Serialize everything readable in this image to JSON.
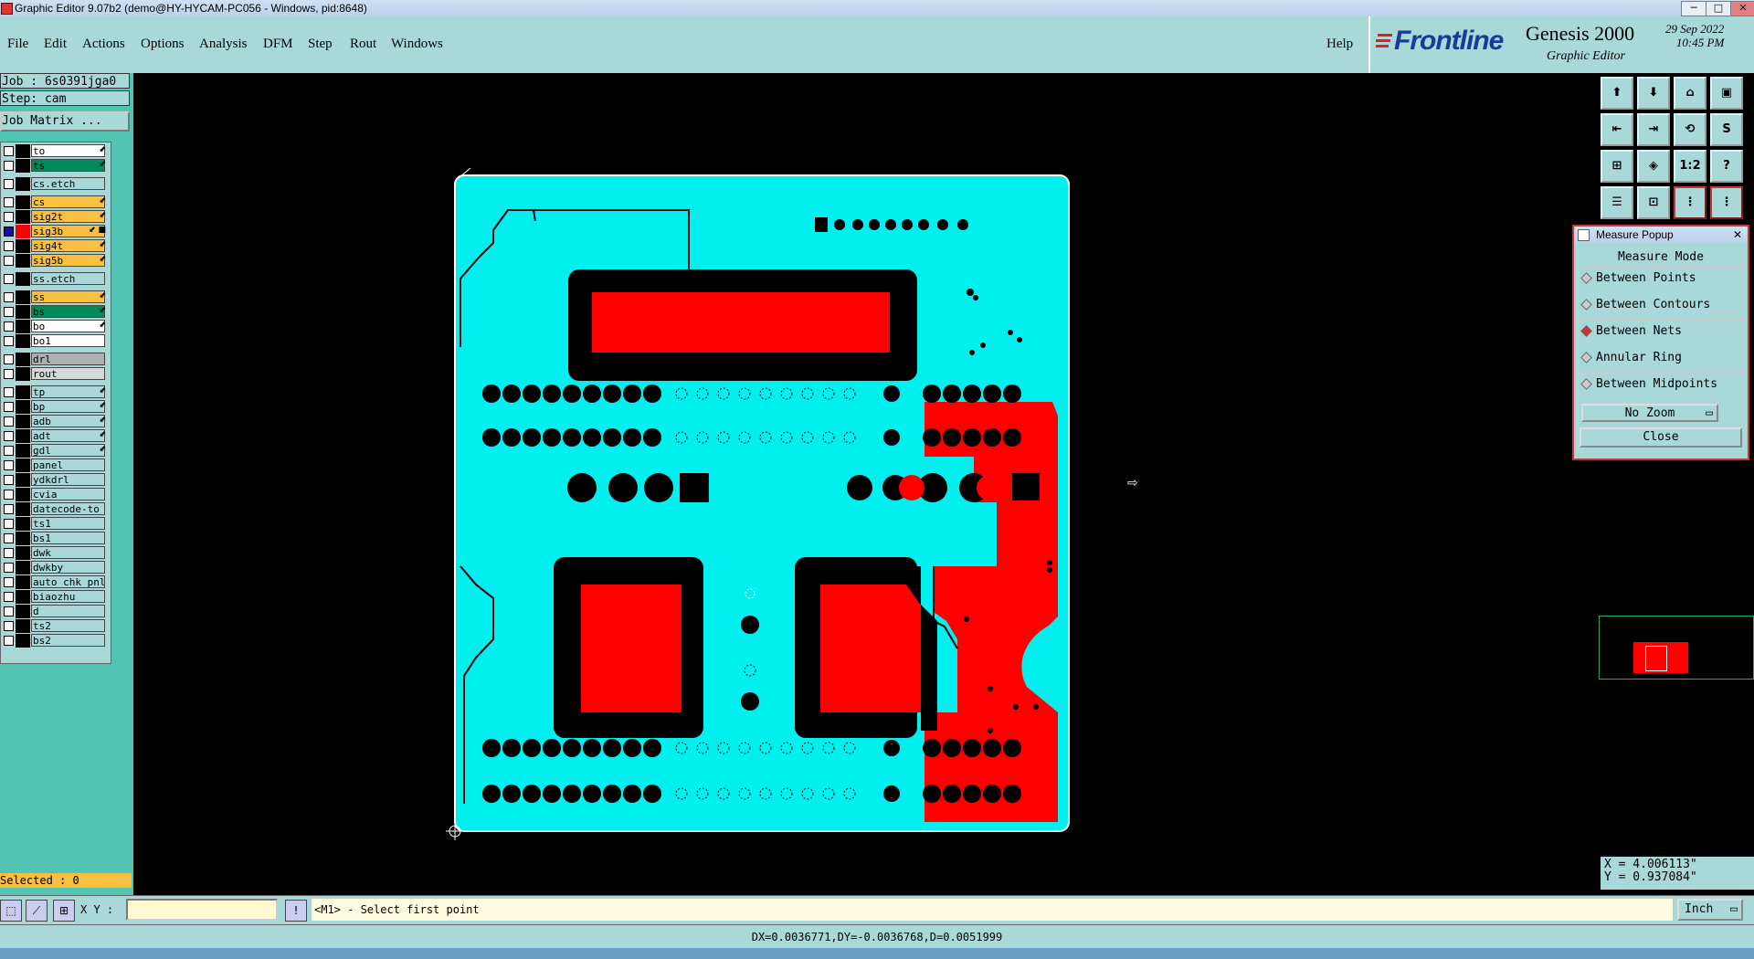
{
  "window": {
    "title": "Graphic Editor 9.07b2 (demo@HY-HYCAM-PC056 - Windows, pid:8648)",
    "min": "─",
    "max": "□",
    "close": "✕"
  },
  "menu": {
    "file": "File",
    "edit": "Edit",
    "actions": "Actions",
    "options": "Options",
    "analysis": "Analysis",
    "dfm": "DFM",
    "step": "Step",
    "rout": "Rout",
    "windows": "Windows",
    "help": "Help"
  },
  "brand": {
    "logo": "Frontline",
    "product": "Genesis 2000",
    "subtitle": "Graphic Editor",
    "date": "29 Sep 2022",
    "time": "10:45 PM"
  },
  "job": {
    "job_line": "Job : 6s0391jga0",
    "step_line": "Step: cam",
    "matrix_button": "Job Matrix ..."
  },
  "layers": [
    {
      "name": "to",
      "color": "#ffffff",
      "flag": "⬋",
      "sel": false
    },
    {
      "name": "ts",
      "color": "#008a5a",
      "flag": "⬋",
      "sel": false
    },
    {
      "name": "cs.etch",
      "color": "#a8d8d8",
      "flag": "",
      "sel": false
    },
    {
      "name": "cs",
      "color": "#f8c040",
      "flag": "⬋",
      "sel": false
    },
    {
      "name": "sig2t",
      "color": "#f8c040",
      "flag": "⬋",
      "sel": false
    },
    {
      "name": "sig3b",
      "color": "#f8c040",
      "flag": "⬋ ■",
      "sel": true
    },
    {
      "name": "sig4t",
      "color": "#f8c040",
      "flag": "⬋",
      "sel": false
    },
    {
      "name": "sig5b",
      "color": "#f8c040",
      "flag": "⬋",
      "sel": false
    },
    {
      "name": "ss.etch",
      "color": "#a8d8d8",
      "flag": "",
      "sel": false
    },
    {
      "name": "ss",
      "color": "#f8c040",
      "flag": "⬋",
      "sel": false
    },
    {
      "name": "bs",
      "color": "#008a5a",
      "flag": "⬋",
      "sel": false
    },
    {
      "name": "bo",
      "color": "#ffffff",
      "flag": "⬋",
      "sel": false
    },
    {
      "name": "bo1",
      "color": "#ffffff",
      "flag": "",
      "sel": false
    },
    {
      "name": "drl",
      "color": "#b0b0b0",
      "flag": "",
      "sel": false
    },
    {
      "name": "rout",
      "color": "#d8d8d8",
      "flag": "",
      "sel": false
    },
    {
      "name": "tp",
      "color": "#a8d8d8",
      "flag": "⬋",
      "sel": false
    },
    {
      "name": "bp",
      "color": "#a8d8d8",
      "flag": "⬋",
      "sel": false
    },
    {
      "name": "adb",
      "color": "#a8d8d8",
      "flag": "⬋",
      "sel": false
    },
    {
      "name": "adt",
      "color": "#a8d8d8",
      "flag": "⬋",
      "sel": false
    },
    {
      "name": "gdl",
      "color": "#a8d8d8",
      "flag": "⬋",
      "sel": false
    },
    {
      "name": "panel",
      "color": "#a8d8d8",
      "flag": "",
      "sel": false
    },
    {
      "name": "ydkdrl",
      "color": "#a8d8d8",
      "flag": "",
      "sel": false
    },
    {
      "name": "cvia",
      "color": "#a8d8d8",
      "flag": "",
      "sel": false
    },
    {
      "name": "datecode-to",
      "color": "#a8d8d8",
      "flag": "",
      "sel": false
    },
    {
      "name": "ts1",
      "color": "#a8d8d8",
      "flag": "",
      "sel": false
    },
    {
      "name": "bs1",
      "color": "#a8d8d8",
      "flag": "",
      "sel": false
    },
    {
      "name": "dwk",
      "color": "#a8d8d8",
      "flag": "",
      "sel": false
    },
    {
      "name": "dwkby",
      "color": "#a8d8d8",
      "flag": "",
      "sel": false
    },
    {
      "name": "auto_chk_pnl",
      "color": "#a8d8d8",
      "flag": "",
      "sel": false
    },
    {
      "name": "biaozhu",
      "color": "#a8d8d8",
      "flag": "",
      "sel": false
    },
    {
      "name": "d",
      "color": "#a8d8d8",
      "flag": "",
      "sel": false
    },
    {
      "name": "ts2",
      "color": "#a8d8d8",
      "flag": "",
      "sel": false
    },
    {
      "name": "bs2",
      "color": "#a8d8d8",
      "flag": "",
      "sel": false
    }
  ],
  "selected": "Selected : 0",
  "tools": {
    "zoom_ratio": "1:2",
    "help": "?"
  },
  "measure": {
    "title": "Measure Popup",
    "mode_label": "Measure Mode",
    "options": [
      {
        "label": "Between Points",
        "on": false
      },
      {
        "label": "Between Contours",
        "on": false
      },
      {
        "label": "Between Nets",
        "on": true
      },
      {
        "label": "Annular Ring",
        "on": false
      },
      {
        "label": "Between Midpoints",
        "on": false
      }
    ],
    "zoom": "No Zoom",
    "close": "Close"
  },
  "coords": {
    "x": "X = 4.006113\"",
    "y": "Y = 0.937084\""
  },
  "status": {
    "xy_label": "X Y :",
    "xy_value": "",
    "prompt": "<M1> - Select first point",
    "unit": "Inch",
    "delta": "DX=0.0036771,DY=-0.0036768,D=0.0051999"
  },
  "colors": {
    "board": "#00f0f0",
    "copper": "#ff0000",
    "background": "#000000",
    "panel": "#a8d8d8"
  }
}
